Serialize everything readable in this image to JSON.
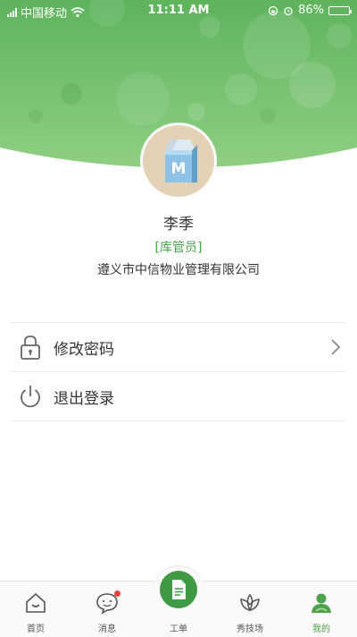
{
  "status_bar": {
    "carrier": "中国移动",
    "time": "11:11 AM",
    "battery": "86%",
    "battery_level": 0.86
  },
  "profile": {
    "name": "李季",
    "role": "[库管员]",
    "company": "遵义市中信物业管理有限公司",
    "avatar_letter": "M"
  },
  "menu": {
    "items": [
      {
        "label": "修改密码",
        "icon": "lock-icon"
      },
      {
        "label": "退出登录",
        "icon": "power-icon"
      }
    ]
  },
  "tabbar": {
    "items": [
      {
        "label": "首页",
        "icon": "home-icon"
      },
      {
        "label": "消息",
        "icon": "message-icon",
        "badge": true
      },
      {
        "label": "工单",
        "icon": "work-order-icon"
      },
      {
        "label": "秀技场",
        "icon": "lotus-icon"
      },
      {
        "label": "我的",
        "icon": "profile-icon",
        "active": true
      }
    ]
  },
  "colors": {
    "accent": "#4ca24c",
    "header_green": "#6dbd6a",
    "badge_red": "#e8443a"
  }
}
